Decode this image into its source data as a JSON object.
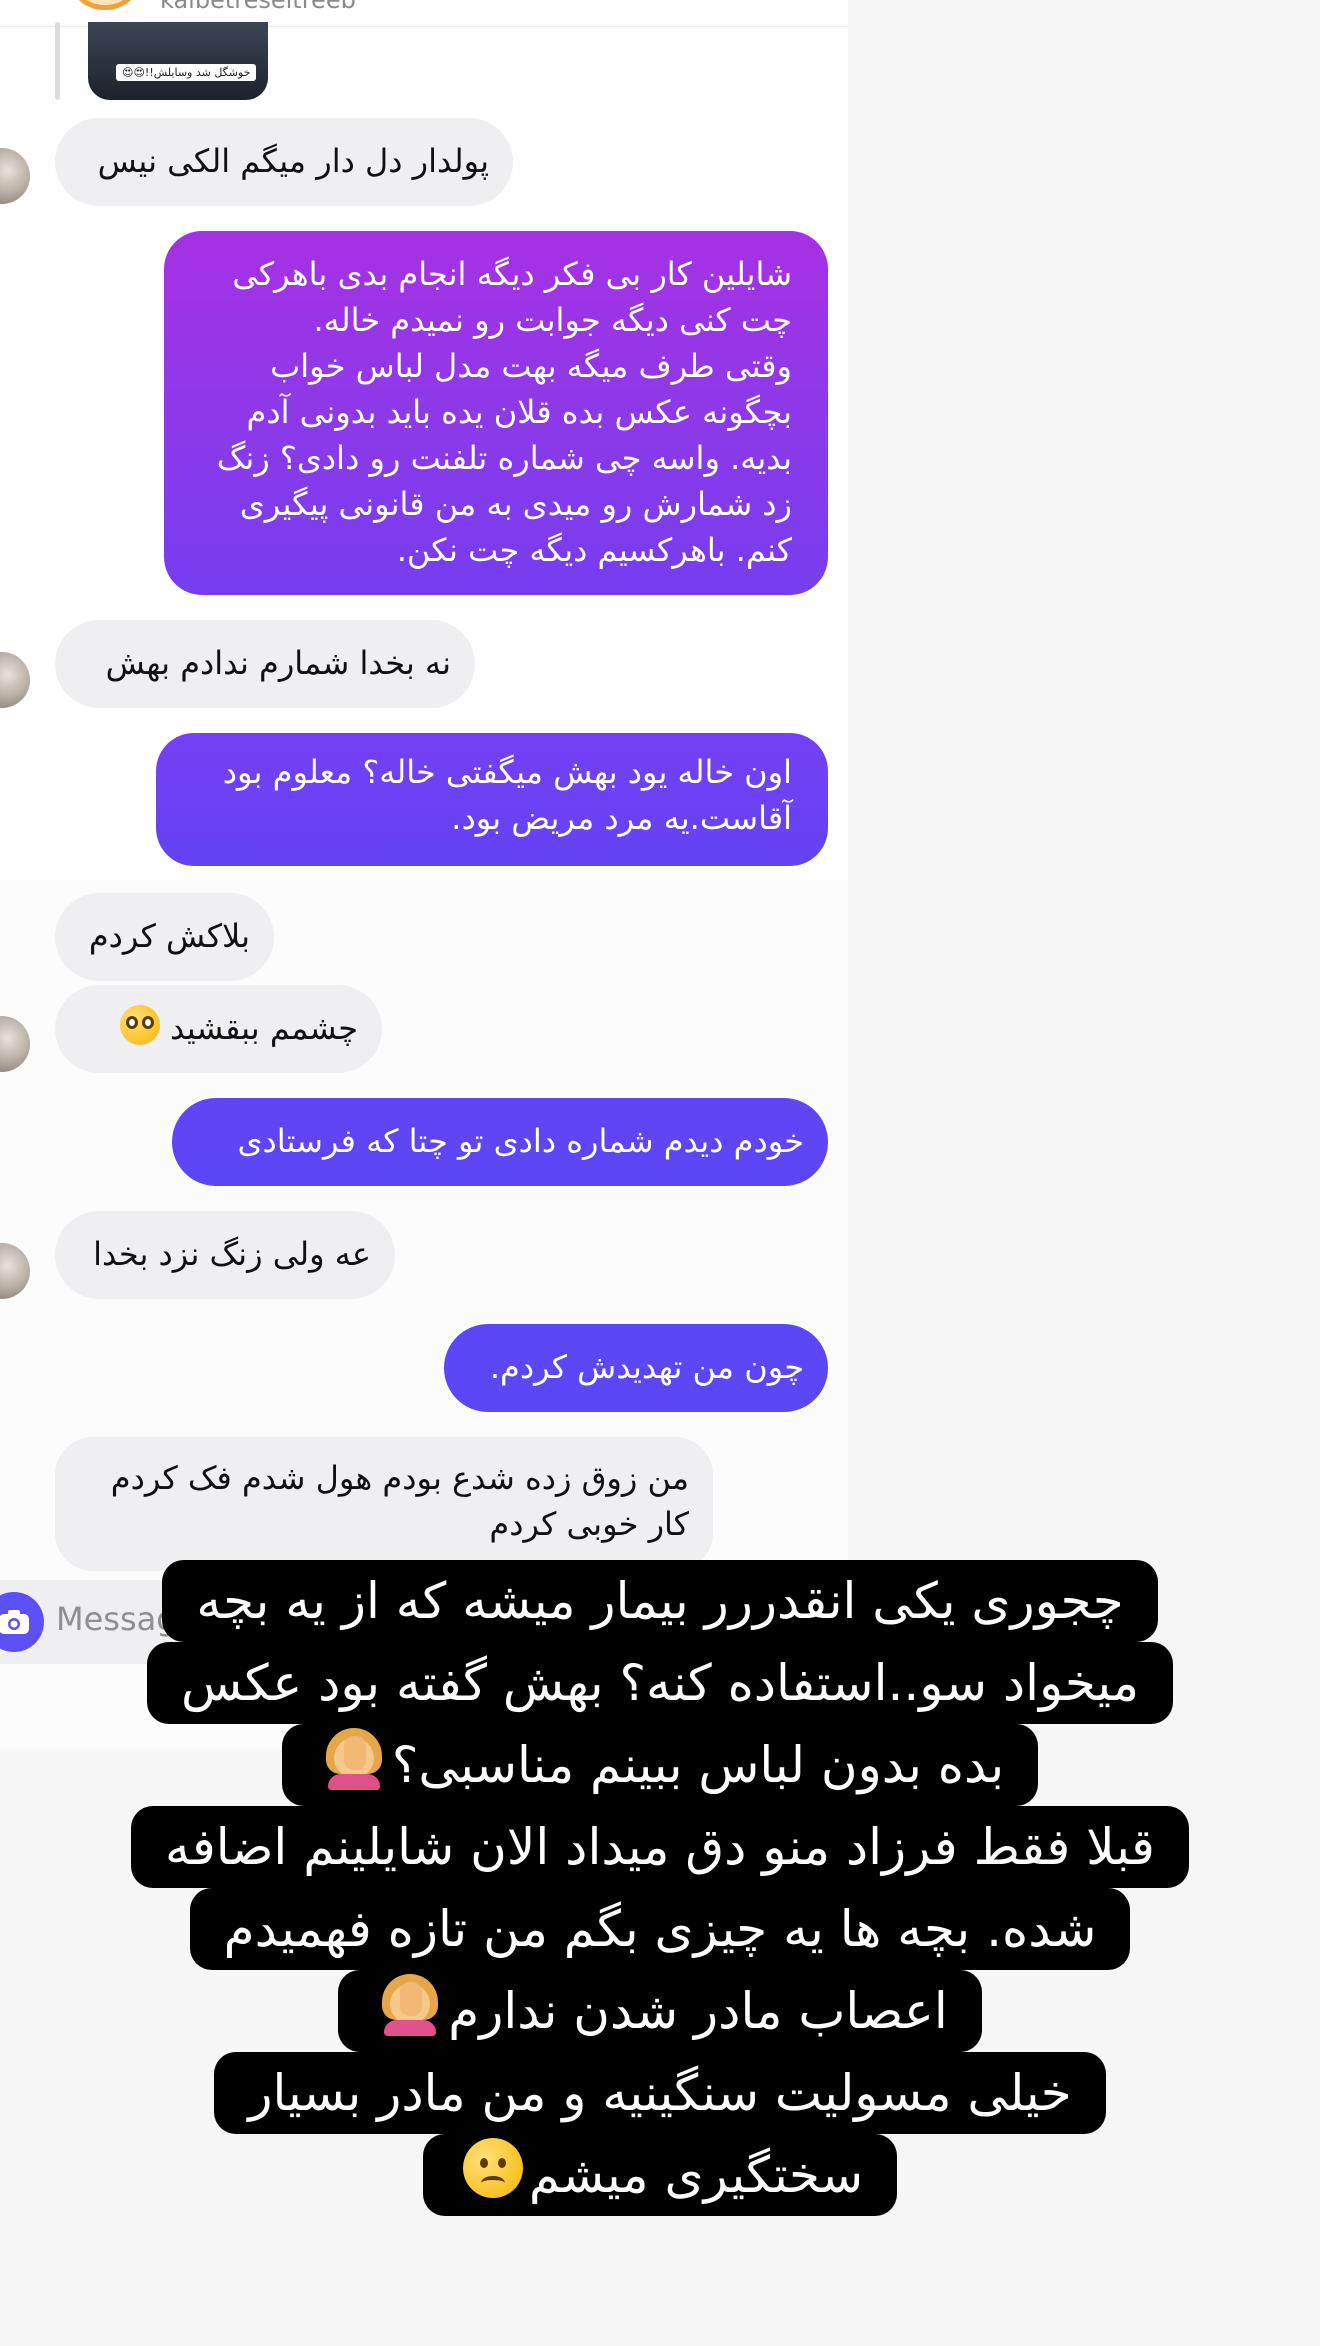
{
  "conversation": {
    "username": "kalbetreseitreeb",
    "reply_caption": "خوشگل شد وسایلش!!😍😍",
    "messages": [
      {
        "side": "in",
        "text": "پولدار دل دار میگم الکی نیس"
      },
      {
        "side": "out",
        "lines": [
          "شایلین کار بی فکر دیگه انجام بدی باهرکی",
          "چت کنی دیگه جوابت رو نمیدم خاله.",
          "وقتی طرف میگه بهت مدل لباس خواب",
          "بچگونه عکس بده قلان یده باید بدونی آدم",
          "بدیه. واسه چی شماره تلفنت رو دادی؟ زنگ",
          "زد شمارش رو میدی به من قانونی پیگیری",
          "کنم. باهرکسیم دیگه چت نکن."
        ]
      },
      {
        "side": "in",
        "text": "نه بخدا شمارم ندادم بهش"
      },
      {
        "side": "out",
        "lines": [
          "اون خاله یود بهش میگفتی خاله؟ معلوم بود",
          "آقاست.یه مرد مریض بود."
        ]
      },
      {
        "side": "in",
        "text": "بلاکش کردم"
      },
      {
        "side": "in",
        "text": "چشمم ببقشید"
      },
      {
        "side": "out",
        "text": "خودم دیدم شماره دادی تو چتا که فرستادی"
      },
      {
        "side": "in",
        "text": "عه ولی زنگ نزد بخدا"
      },
      {
        "side": "out",
        "text": "چون من تهدیدش کردم."
      },
      {
        "side": "in",
        "lines": [
          "من زوق زده شدع بودم هول شدم فک کردم",
          "کار خوبی کردم"
        ]
      }
    ]
  },
  "composer": {
    "placeholder": "Message..."
  },
  "story_overlay": {
    "lines": [
      "چجوری یکی انقدررر بیمار میشه که از یه بچه",
      "میخواد سو..استفاده کنه؟ بهش گفته بود عکس",
      "بده بدون لباس ببینم مناسبی؟",
      "قبلا فقط فرزاد منو دق میداد الان شایلینم اضافه",
      "شده. بچه ها یه چیزی بگم من تازه فهمیدم",
      "اعصاب مادر شدن ندارم",
      "خیلی مسولیت سنگینیه و من مادر بسیار",
      "سختگیری میشم"
    ]
  },
  "colors": {
    "incoming_bubble": "#efeff2",
    "outgoing_gradient_top": "#a631e4",
    "outgoing_gradient_bottom": "#5b46f5",
    "story_background": "#000000"
  }
}
